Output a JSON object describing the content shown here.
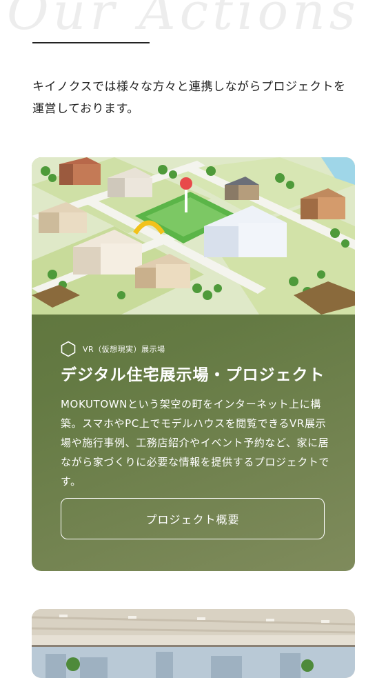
{
  "section": {
    "script_title": "Our Actions",
    "intro": "キイノクスでは様々な方々と連携しながらプロジェクトを運営しております。"
  },
  "project": {
    "image_alt": "MOKUTOWN illustration",
    "category": "VR（仮想現実）展示場",
    "title": "デジタル住宅展示場・プロジェクト",
    "description": "MOKUTOWNという架空の町をインターネット上に構築。スマホやPC上でモデルハウスを閲覧できるVR展示場や施行事例、工務店紹介やイベント予約など、家に居ながら家づくりに必要な情報を提供するプロジェクトです。",
    "button_label": "プロジェクト概要"
  },
  "colors": {
    "card_green": "#5f763c",
    "text_white": "#ffffff"
  }
}
